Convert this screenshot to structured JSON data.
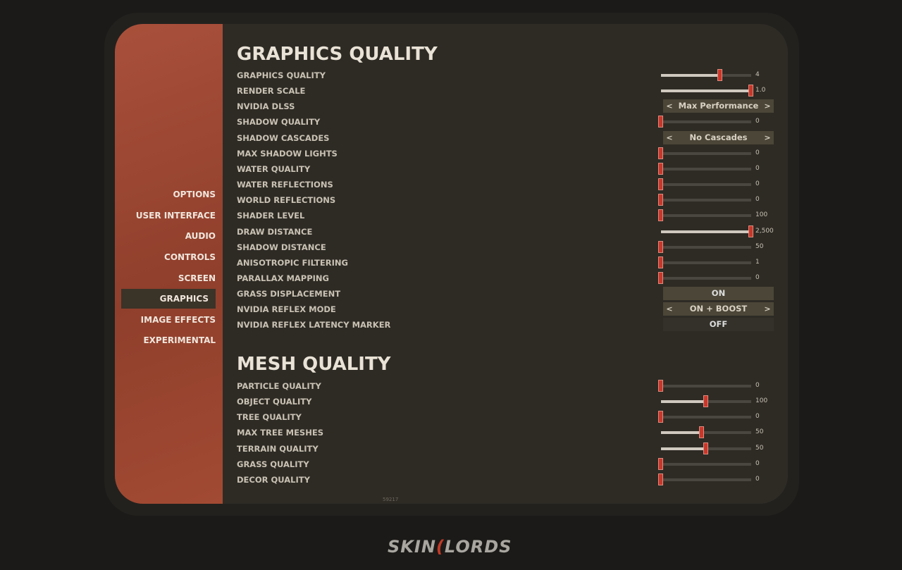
{
  "sidebar": {
    "items": [
      {
        "label": "OPTIONS"
      },
      {
        "label": "USER INTERFACE"
      },
      {
        "label": "AUDIO"
      },
      {
        "label": "CONTROLS"
      },
      {
        "label": "SCREEN"
      },
      {
        "label": "GRAPHICS",
        "active": true
      },
      {
        "label": "IMAGE EFFECTS"
      },
      {
        "label": "EXPERIMENTAL"
      }
    ]
  },
  "sections": [
    {
      "title": "GRAPHICS QUALITY",
      "rows": [
        {
          "label": "GRAPHICS QUALITY",
          "type": "slider",
          "value": "4",
          "fraction": 0.66
        },
        {
          "label": "RENDER SCALE",
          "type": "slider",
          "value": "1.0",
          "fraction": 1
        },
        {
          "label": "NVIDIA DLSS",
          "type": "select",
          "value": "Max Performance"
        },
        {
          "label": "SHADOW QUALITY",
          "type": "slider",
          "value": "0",
          "fraction": 0
        },
        {
          "label": "SHADOW CASCADES",
          "type": "select",
          "value": "No Cascades"
        },
        {
          "label": "MAX SHADOW LIGHTS",
          "type": "slider",
          "value": "0",
          "fraction": 0
        },
        {
          "label": "WATER QUALITY",
          "type": "slider",
          "value": "0",
          "fraction": 0
        },
        {
          "label": "WATER REFLECTIONS",
          "type": "slider",
          "value": "0",
          "fraction": 0
        },
        {
          "label": "WORLD REFLECTIONS",
          "type": "slider",
          "value": "0",
          "fraction": 0
        },
        {
          "label": "SHADER LEVEL",
          "type": "slider",
          "value": "100",
          "fraction": 0
        },
        {
          "label": "DRAW DISTANCE",
          "type": "slider",
          "value": "2,500",
          "fraction": 1
        },
        {
          "label": "SHADOW DISTANCE",
          "type": "slider",
          "value": "50",
          "fraction": 0
        },
        {
          "label": "ANISOTROPIC FILTERING",
          "type": "slider",
          "value": "1",
          "fraction": 0
        },
        {
          "label": "PARALLAX MAPPING",
          "type": "slider",
          "value": "0",
          "fraction": 0
        },
        {
          "label": "GRASS DISPLACEMENT",
          "type": "toggle",
          "value": "ON"
        },
        {
          "label": "NVIDIA REFLEX MODE",
          "type": "select",
          "value": "ON + BOOST"
        },
        {
          "label": "NVIDIA REFLEX LATENCY MARKER",
          "type": "toggle",
          "value": "OFF"
        }
      ]
    },
    {
      "title": "MESH QUALITY",
      "rows": [
        {
          "label": "PARTICLE QUALITY",
          "type": "slider",
          "value": "0",
          "fraction": 0
        },
        {
          "label": "OBJECT QUALITY",
          "type": "slider",
          "value": "100",
          "fraction": 0.5
        },
        {
          "label": "TREE QUALITY",
          "type": "slider",
          "value": "0",
          "fraction": 0
        },
        {
          "label": "MAX TREE MESHES",
          "type": "slider",
          "value": "50",
          "fraction": 0.45
        },
        {
          "label": "TERRAIN QUALITY",
          "type": "slider",
          "value": "50",
          "fraction": 0.5
        },
        {
          "label": "GRASS QUALITY",
          "type": "slider",
          "value": "0",
          "fraction": 0
        },
        {
          "label": "DECOR QUALITY",
          "type": "slider",
          "value": "0",
          "fraction": 0
        }
      ]
    }
  ],
  "arrows": {
    "left": "<",
    "right": ">"
  },
  "version": "59217",
  "watermark": "SKINLORDS",
  "colors": {
    "accent": "#c8372b",
    "sidebar": "#9b4630"
  }
}
